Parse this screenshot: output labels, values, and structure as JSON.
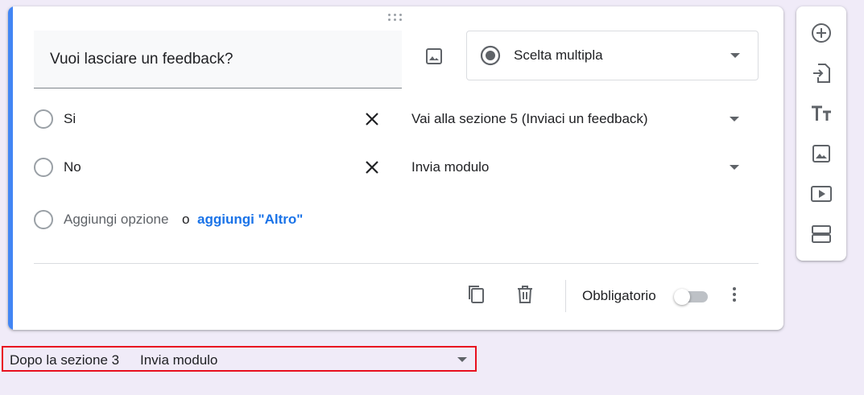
{
  "question": {
    "title": "Vuoi lasciare un feedback?",
    "type_label": "Scelta multipla"
  },
  "options": [
    {
      "label": "Si",
      "goto": "Vai alla sezione 5 (Inviaci un feedback)"
    },
    {
      "label": "No",
      "goto": "Invia modulo"
    }
  ],
  "add_option": {
    "label": "Aggiungi opzione",
    "or": "o",
    "add_other": "aggiungi \"Altro\""
  },
  "footer": {
    "required_label": "Obbligatorio",
    "required_on": false
  },
  "after_section": {
    "label": "Dopo la sezione 3",
    "value": "Invia modulo"
  },
  "colors": {
    "accent": "#4285f4",
    "link": "#1a73e8",
    "highlight_border": "#e8101f",
    "background": "#f0ebf8"
  },
  "icons": [
    "drag-handle-icon",
    "image-icon",
    "radio-checked-icon",
    "chevron-down-icon",
    "close-icon",
    "copy-icon",
    "delete-icon",
    "more-vert-icon",
    "add-circle-icon",
    "import-icon",
    "title-icon",
    "add-image-icon",
    "video-icon",
    "section-icon"
  ]
}
